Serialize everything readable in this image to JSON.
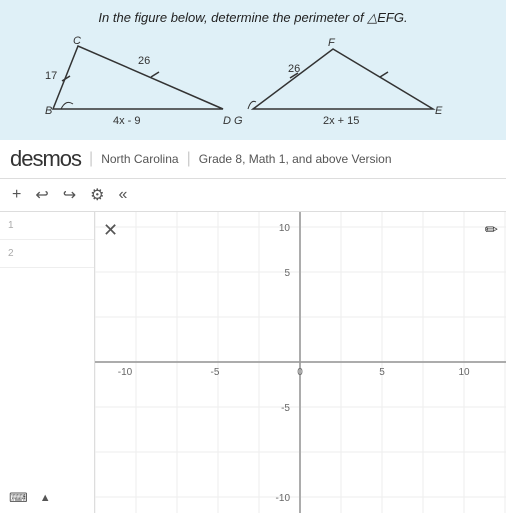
{
  "header": {
    "problem_text": "In the figure below, determine the perimeter of △EFG."
  },
  "figure": {
    "labels": {
      "c": "C",
      "f": "F",
      "b": "B",
      "d": "D",
      "g": "G",
      "e": "E",
      "side_17": "17",
      "side_26_left": "26",
      "side_26_right": "26",
      "side_4x9": "4x-9",
      "side_2x15": "2x+15",
      "label_dg": "DG"
    }
  },
  "desmos": {
    "logo": "desmos",
    "separator1": "|",
    "region": "North Carolina",
    "separator2": "|",
    "grade": "Grade 8, Math 1, and above Version"
  },
  "toolbar": {
    "add_btn": "+",
    "undo_btn": "↩",
    "redo_btn": "↪",
    "settings_btn": "⚙",
    "double_left_btn": "«"
  },
  "sidebar": {
    "row1_num": "1",
    "row2_num": "2",
    "close_icon": "✕",
    "keyboard_icon": "⌨",
    "expand_icon": "▲"
  },
  "graph": {
    "x_min": -10,
    "x_max": 10,
    "y_min": -10,
    "y_max": 10,
    "x_labels": [
      "-10",
      "-5",
      "0",
      "5",
      "10"
    ],
    "y_labels": [
      "10",
      "5",
      "-5",
      "-10"
    ],
    "pencil_icon": "✏"
  },
  "colors": {
    "background": "#dff0f7",
    "white": "#ffffff",
    "border": "#dddddd",
    "text_dark": "#222222",
    "text_mid": "#555555",
    "accent_blue": "#3d9bcc"
  }
}
